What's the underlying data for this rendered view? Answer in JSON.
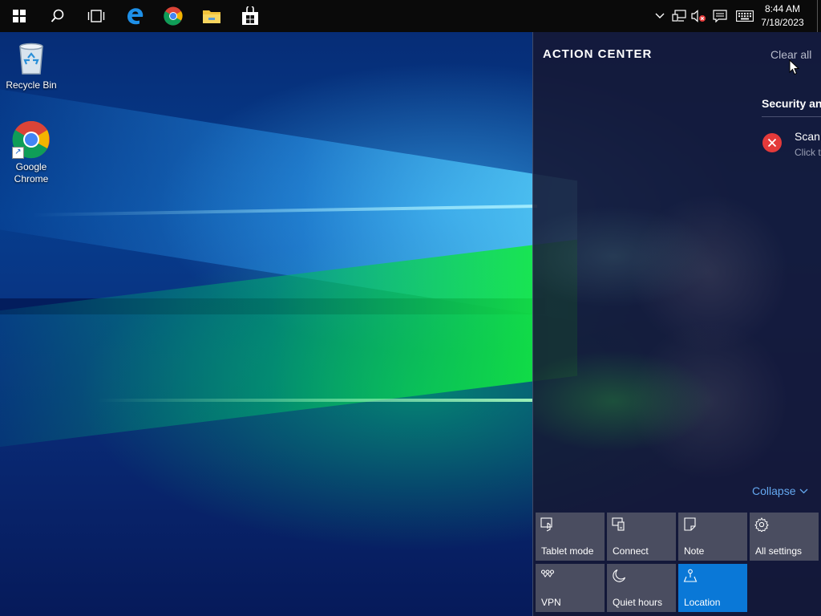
{
  "desktop": {
    "icons": [
      {
        "label": "Recycle Bin",
        "icon": "recycle-bin-icon"
      },
      {
        "label": "Google Chrome",
        "icon": "chrome-icon"
      }
    ]
  },
  "taskbar": {
    "apps": [
      {
        "name": "start",
        "icon": "windows-logo-icon"
      },
      {
        "name": "search",
        "icon": "search-icon"
      },
      {
        "name": "task-view",
        "icon": "task-view-icon"
      },
      {
        "name": "edge",
        "icon": "edge-icon"
      },
      {
        "name": "chrome",
        "icon": "chrome-icon"
      },
      {
        "name": "file-explorer",
        "icon": "folder-icon"
      },
      {
        "name": "store",
        "icon": "store-icon"
      }
    ],
    "tray": {
      "icons": [
        "chevron-up-icon",
        "network-icon",
        "volume-muted-icon",
        "action-center-icon",
        "keyboard-icon"
      ],
      "time": "8:44 AM",
      "date": "7/18/2023"
    }
  },
  "action_center": {
    "title": "ACTION CENTER",
    "clear_all": "Clear all",
    "notification_group": "Security and Maintenance",
    "notification": {
      "title": "Scan",
      "subtitle": "Click t",
      "icon": "error-x-icon",
      "icon_color": "#e43a3a"
    },
    "collapse": "Collapse",
    "tiles": [
      {
        "label": "Tablet mode",
        "icon": "tablet-mode-icon",
        "active": false
      },
      {
        "label": "Connect",
        "icon": "connect-icon",
        "active": false
      },
      {
        "label": "Note",
        "icon": "note-icon",
        "active": false
      },
      {
        "label": "All settings",
        "icon": "gear-icon",
        "active": false
      },
      {
        "label": "VPN",
        "icon": "vpn-icon",
        "active": false
      },
      {
        "label": "Quiet hours",
        "icon": "moon-icon",
        "active": false
      },
      {
        "label": "Location",
        "icon": "location-icon",
        "active": true
      }
    ],
    "accent_color": "#0a78d7",
    "link_color": "#64a8f0"
  }
}
